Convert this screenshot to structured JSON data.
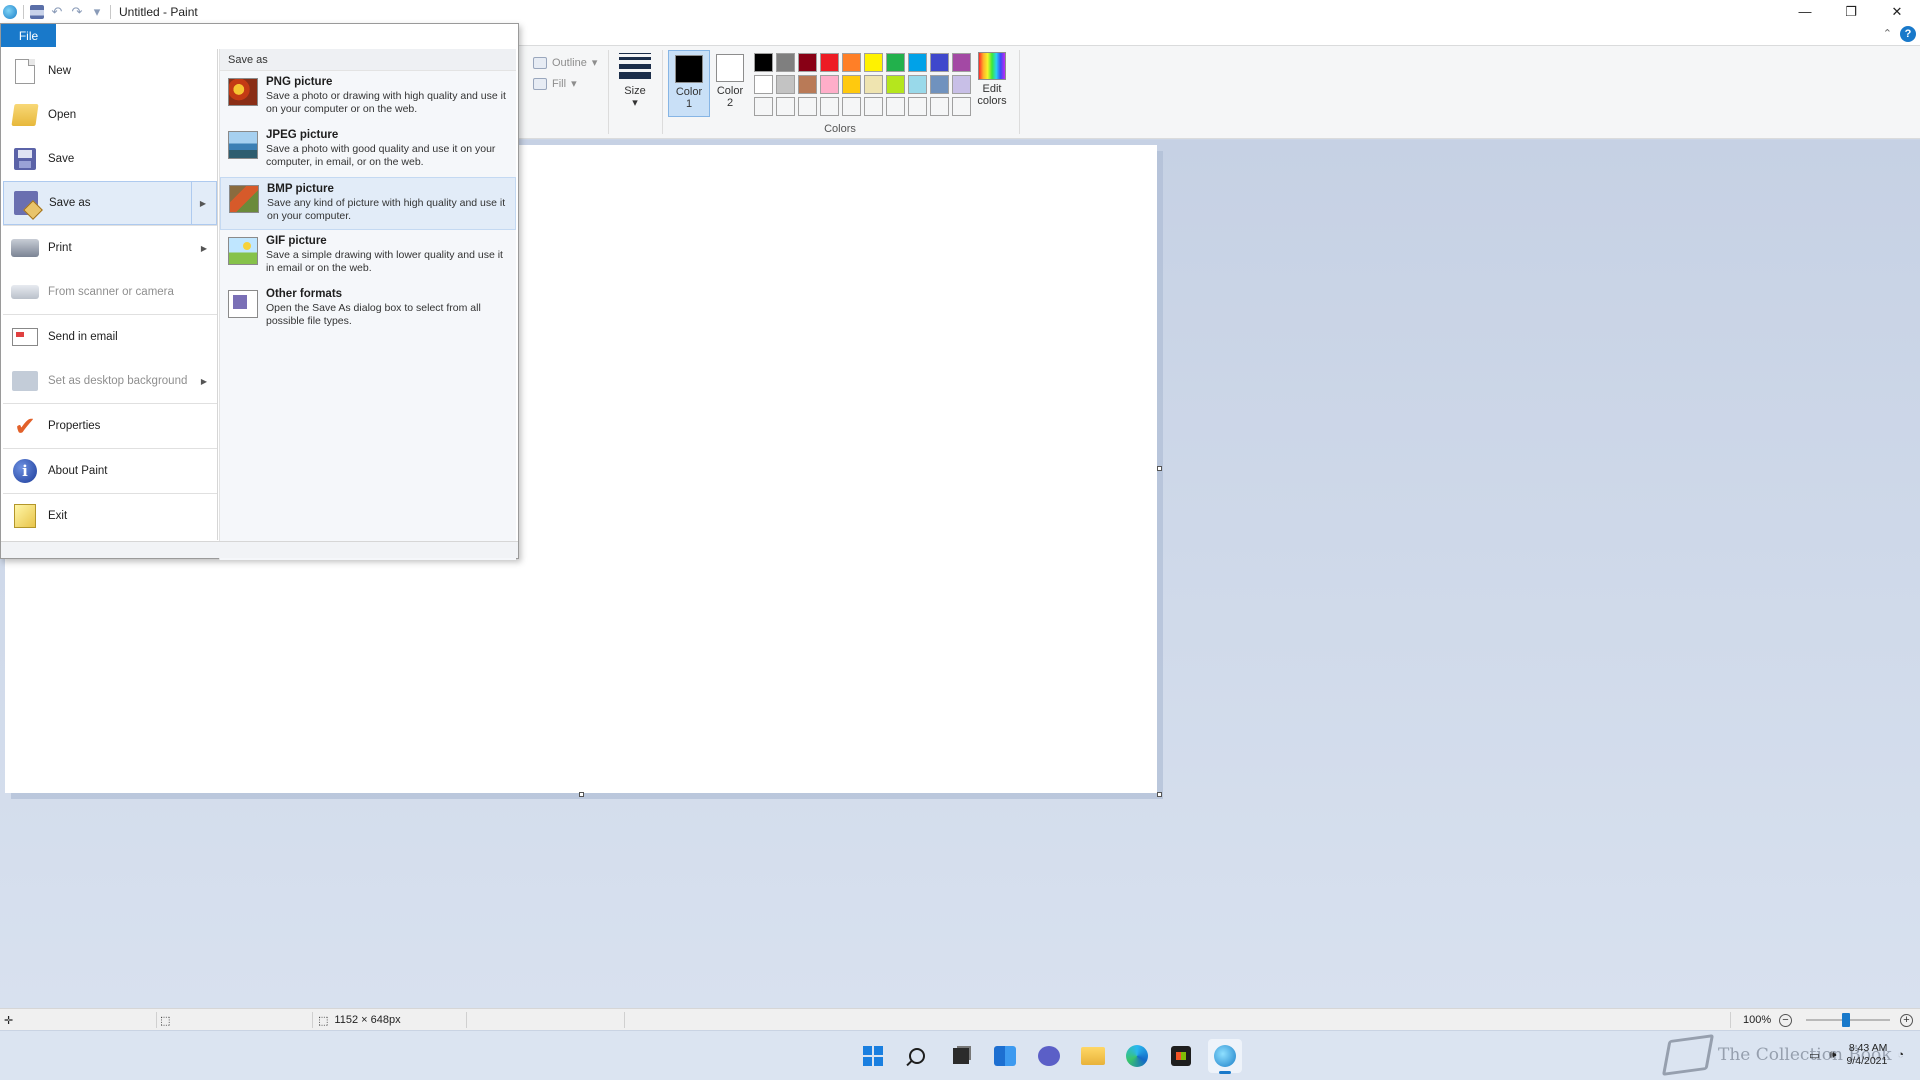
{
  "window": {
    "title": "Untitled - Paint",
    "minimize_glyph": "—",
    "maximize_glyph": "❐",
    "close_glyph": "✕"
  },
  "quick_access": {
    "undo_glyph": "↶",
    "redo_glyph": "↷",
    "customize_glyph": "▾"
  },
  "ribbon": {
    "file_tab": "File",
    "collapse_glyph": "⌃",
    "help_glyph": "?",
    "outline_label": "Outline",
    "fill_label": "Fill",
    "size_label": "Size",
    "color1_label": "Color 1",
    "color2_label": "Color 2",
    "edit_colors_label": "Edit colors",
    "colors_group_label": "Colors",
    "color1_value": "#000000",
    "color2_value": "#ffffff",
    "palette": [
      "#000000",
      "#7f7f7f",
      "#880015",
      "#ed1c24",
      "#ff7f27",
      "#fff200",
      "#22b14c",
      "#00a2e8",
      "#3f48cc",
      "#a349a4",
      "#ffffff",
      "#c3c3c3",
      "#b97a57",
      "#ffaec9",
      "#ffc90e",
      "#efe4b0",
      "#b5e61d",
      "#99d9ea",
      "#7092be",
      "#c8bfe7",
      "#f5f6f7",
      "#f5f6f7",
      "#f5f6f7",
      "#f5f6f7",
      "#f5f6f7",
      "#f5f6f7",
      "#f5f6f7",
      "#f5f6f7",
      "#f5f6f7",
      "#f5f6f7"
    ]
  },
  "file_menu": {
    "commands": [
      {
        "label": "New",
        "icon": "new-document-icon",
        "disabled": false
      },
      {
        "label": "Open",
        "icon": "open-folder-icon",
        "disabled": false
      },
      {
        "label": "Save",
        "icon": "save-disk-icon",
        "disabled": false
      },
      {
        "label": "Save as",
        "icon": "save-as-icon",
        "disabled": false,
        "submenu": true,
        "active": true
      },
      {
        "label": "Print",
        "icon": "printer-icon",
        "disabled": false,
        "submenu": true
      },
      {
        "label": "From scanner or camera",
        "icon": "scanner-icon",
        "disabled": true
      },
      {
        "label": "Send in email",
        "icon": "email-icon",
        "disabled": false
      },
      {
        "label": "Set as desktop background",
        "icon": "desktop-background-icon",
        "disabled": true,
        "submenu": true
      },
      {
        "label": "Properties",
        "icon": "checkmark-icon",
        "disabled": false
      },
      {
        "label": "About Paint",
        "icon": "info-icon",
        "disabled": false
      },
      {
        "label": "Exit",
        "icon": "exit-icon",
        "disabled": false
      }
    ],
    "submenu_arrow": "▶",
    "save_as": {
      "title": "Save as",
      "items": [
        {
          "name": "PNG picture",
          "description": "Save a photo or drawing with high quality and use it on your computer or on the web.",
          "icon": "png-picture-icon"
        },
        {
          "name": "JPEG picture",
          "description": "Save a photo with good quality and use it on your computer, in email, or on the web.",
          "icon": "jpeg-picture-icon"
        },
        {
          "name": "BMP picture",
          "description": "Save any kind of picture with high quality and use it on your computer.",
          "icon": "bmp-picture-icon",
          "active": true
        },
        {
          "name": "GIF picture",
          "description": "Save a simple drawing with lower quality and use it in email or on the web.",
          "icon": "gif-picture-icon"
        },
        {
          "name": "Other formats",
          "description": "Open the Save As dialog box to select from all possible file types.",
          "icon": "other-formats-icon"
        }
      ]
    }
  },
  "statusbar": {
    "canvas_size": "1152 × 648px",
    "zoom_level": "100%",
    "zoom_out_glyph": "−",
    "zoom_in_glyph": "+"
  },
  "taskbar": {
    "clock_time": "8:43 AM",
    "clock_date": "9/4/2021",
    "watermark_text": "The Collection Book"
  }
}
